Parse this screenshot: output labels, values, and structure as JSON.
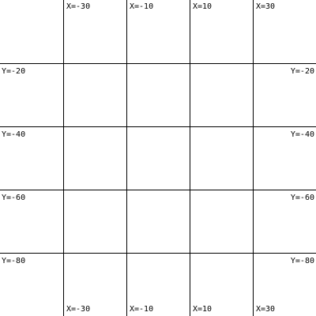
{
  "grid": {
    "x_labels": [
      "X=-30",
      "X=-10",
      "X=10",
      "X=30"
    ],
    "y_labels": [
      "Y=-20",
      "Y=-40",
      "Y=-60",
      "Y=-80"
    ]
  },
  "colors": {
    "background": "#ffffff",
    "grid_line": "#000000",
    "label_text": "#000000"
  }
}
